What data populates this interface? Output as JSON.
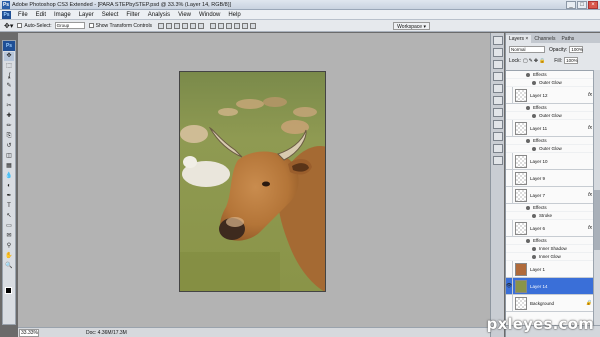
{
  "window": {
    "app_badge": "Ps",
    "title": "Adobe Photoshop CS3 Extended - [PARA STEPbySTEP.psd @ 33.3% (Layer 14, RGB/8)]",
    "min": "_",
    "max": "□",
    "close": "×"
  },
  "menu": {
    "logo": "Ps",
    "items": [
      "File",
      "Edit",
      "Image",
      "Layer",
      "Select",
      "Filter",
      "Analysis",
      "View",
      "Window",
      "Help"
    ]
  },
  "options": {
    "auto_select_label": "Auto-Select:",
    "auto_select_value": "Group",
    "show_transform_label": "Show Transform Controls",
    "workspace_label": "Workspace ▾"
  },
  "toolbox": {
    "badge": "Ps",
    "tools": [
      "move-tool",
      "marquee-tool",
      "lasso-tool",
      "quick-select-tool",
      "crop-tool",
      "slice-tool",
      "healing-brush-tool",
      "brush-tool",
      "clone-stamp-tool",
      "history-brush-tool",
      "eraser-tool",
      "gradient-tool",
      "blur-tool",
      "dodge-tool",
      "pen-tool",
      "type-tool",
      "path-select-tool",
      "shape-tool",
      "notes-tool",
      "eyedropper-tool",
      "hand-tool",
      "zoom-tool"
    ],
    "glyphs": [
      "✥",
      "⬚",
      "ʆ",
      "✎",
      "⌗",
      "✂",
      "✚",
      "✏",
      "⎘",
      "↺",
      "◫",
      "▦",
      "💧",
      "◐",
      "✒",
      "T",
      "↖",
      "▭",
      "✉",
      "⚲",
      "✋",
      "🔍"
    ],
    "foreground_color": "#000000",
    "background_color": "#ffffff"
  },
  "status": {
    "zoom": "33.33%",
    "doc_size": "Doc: 4.36M/17.3M"
  },
  "layers_panel": {
    "tabs": [
      "Layers ×",
      "Channels",
      "Paths"
    ],
    "blend_mode": "Normal",
    "opacity_label": "Opacity:",
    "opacity_value": "100%",
    "lock_label": "Lock:",
    "fill_label": "Fill:",
    "fill_value": "100%",
    "rows": [
      {
        "kind": "effect",
        "label": "Effects"
      },
      {
        "kind": "subeffect",
        "label": "Outer Glow"
      },
      {
        "kind": "layer",
        "label": "Layer 12",
        "fx": "fx"
      },
      {
        "kind": "effect",
        "label": "Effects"
      },
      {
        "kind": "subeffect",
        "label": "Outer Glow"
      },
      {
        "kind": "layer",
        "label": "Layer 11",
        "fx": "fx"
      },
      {
        "kind": "effect",
        "label": "Effects"
      },
      {
        "kind": "subeffect",
        "label": "Outer Glow"
      },
      {
        "kind": "layer",
        "label": "Layer 10",
        "fx": ""
      },
      {
        "kind": "layer",
        "label": "Layer 9",
        "fx": ""
      },
      {
        "kind": "layer",
        "label": "Layer 7",
        "fx": "fx"
      },
      {
        "kind": "effect",
        "label": "Effects"
      },
      {
        "kind": "subeffect",
        "label": "Stroke"
      },
      {
        "kind": "layer",
        "label": "Layer 6",
        "fx": "fx"
      },
      {
        "kind": "effect",
        "label": "Effects"
      },
      {
        "kind": "subeffect",
        "label": "Inner Shadow"
      },
      {
        "kind": "subeffect",
        "label": "Inner Glow"
      },
      {
        "kind": "layer",
        "label": "Layer 1",
        "fx": ""
      },
      {
        "kind": "layer-active",
        "label": "Layer 14",
        "fx": ""
      },
      {
        "kind": "layer",
        "label": "Background",
        "fx": "🔒"
      }
    ]
  },
  "watermark": "pxleyes.com",
  "colors": {
    "workspace_gray": "#b3b3b3",
    "active_layer": "#3a6fd8",
    "ps_blue": "#1f4f95"
  }
}
